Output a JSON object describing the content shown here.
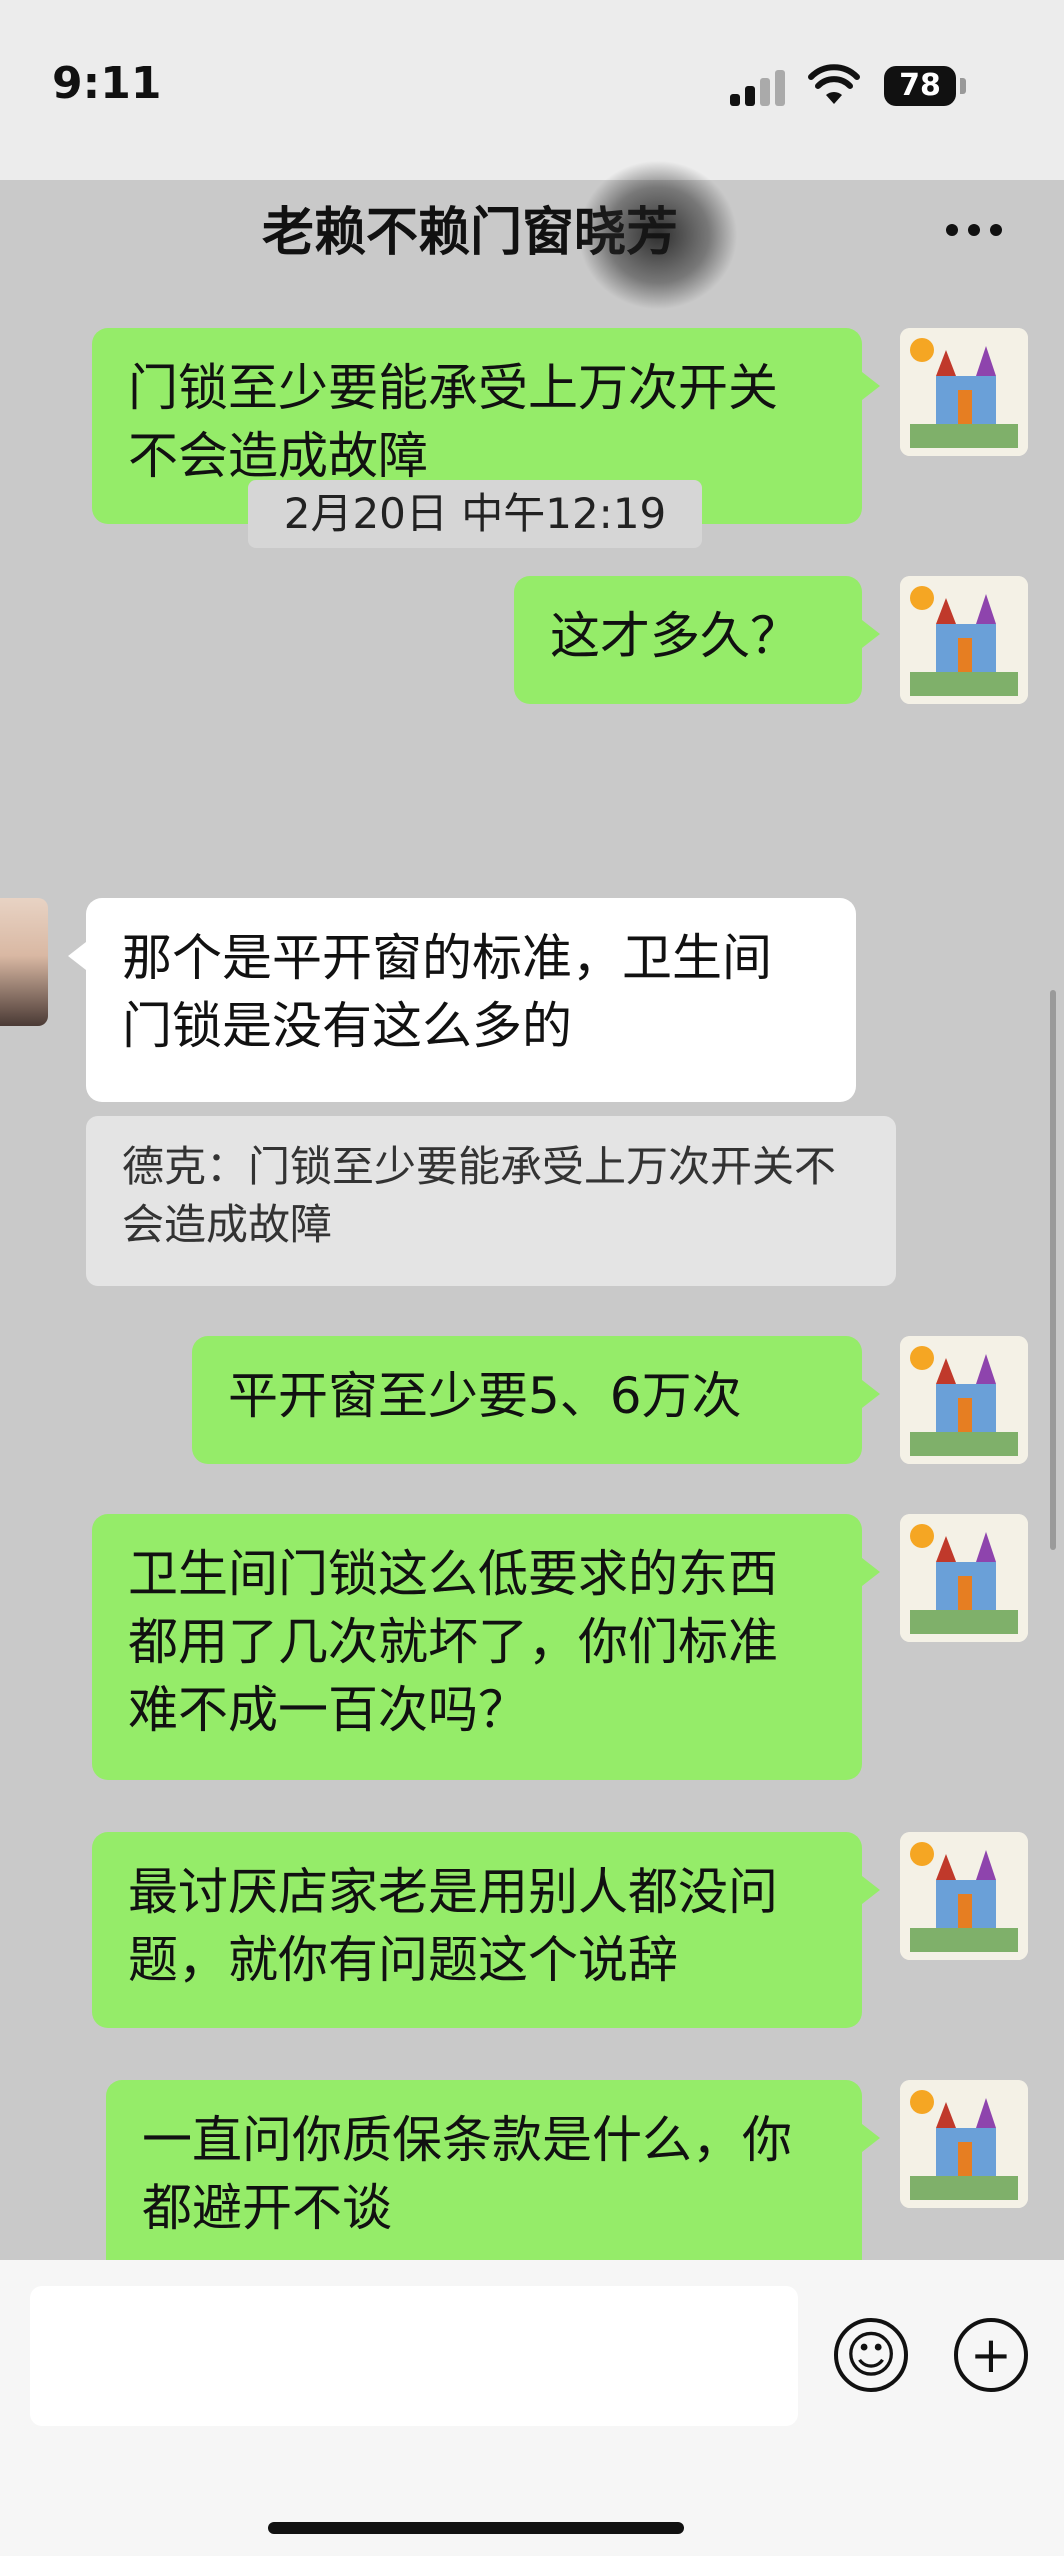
{
  "status_bar": {
    "time": "9:11",
    "battery": "78"
  },
  "header": {
    "title": "老赖不赖门窗晓芳"
  },
  "messages": [
    {
      "side": "right",
      "text": "门锁至少要能承受上万次开关不会造成故障"
    },
    {
      "side": "right",
      "text": "这才多久？"
    },
    {
      "side": "left",
      "text": "那个是平开窗的标准，卫生间门锁是没有这么多的"
    },
    {
      "side": "right",
      "text": "平开窗至少要5、6万次"
    },
    {
      "side": "right",
      "text": "卫生间门锁这么低要求的东西都用了几次就坏了，你们标准难不成一百次吗？"
    },
    {
      "side": "right",
      "text": "最讨厌店家老是用别人都没问题，就你有问题这个说辞"
    },
    {
      "side": "right",
      "text": "一直问你质保条款是什么，你都避开不谈"
    }
  ],
  "timestamp": "2月20日 中午12:19",
  "quote": "德克：门锁至少要能承受上万次开关不会造成故障",
  "input": {
    "emoji_icon": "smiley-icon",
    "plus_icon": "plus-icon"
  },
  "colors": {
    "bubble_green": "#95ec69",
    "chat_bg": "#c9c9c9"
  }
}
